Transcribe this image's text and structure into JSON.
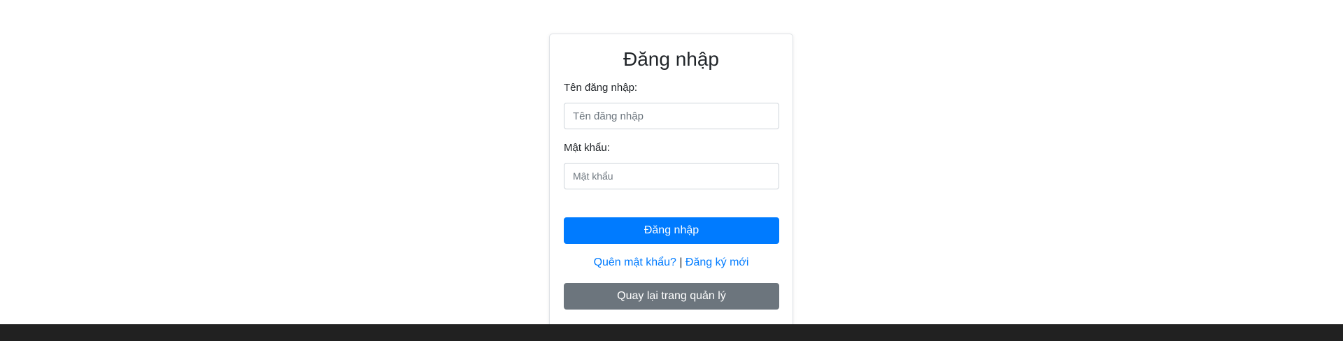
{
  "login_form": {
    "title": "Đăng nhập",
    "username_label": "Tên đăng nhập:",
    "username_placeholder": "Tên đăng nhập",
    "password_label": "Mật khẩu:",
    "password_placeholder": "Mật khẩu",
    "submit_label": "Đăng nhập",
    "forgot_password_link": "Quên mật khẩu?",
    "separator": "|",
    "register_link": "Đăng ký mới",
    "back_button_label": "Quay lại trang quản lý"
  },
  "colors": {
    "primary": "#007bff",
    "secondary": "#6c757d",
    "footer": "#212121"
  }
}
